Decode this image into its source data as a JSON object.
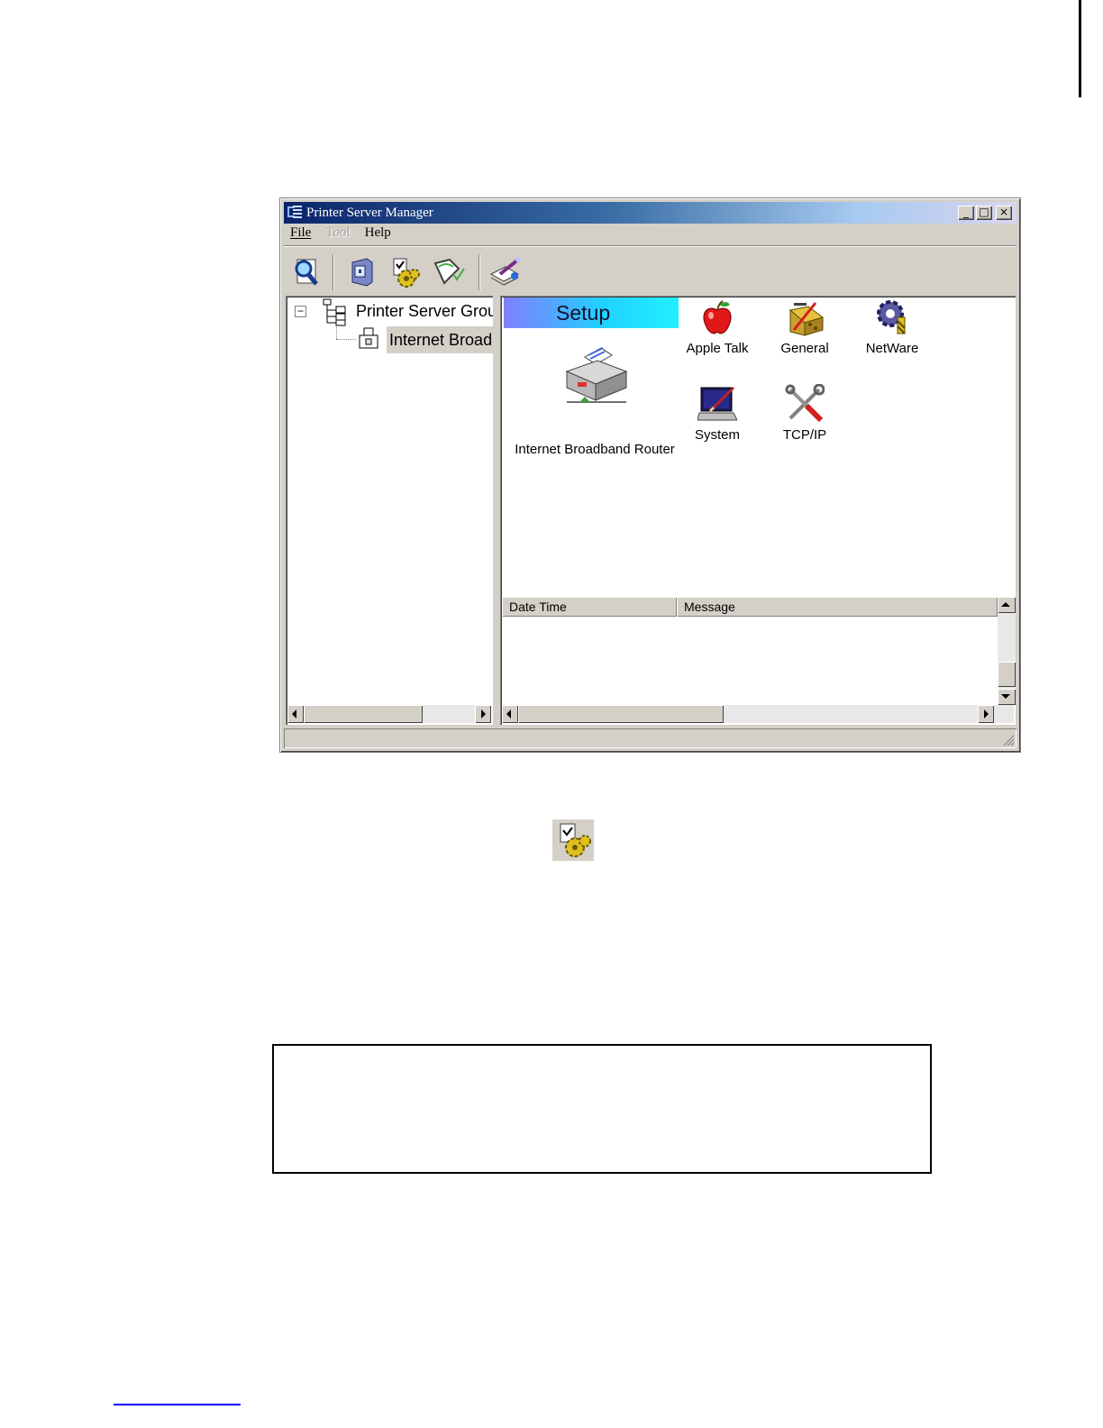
{
  "window": {
    "title": "Printer Server Manager",
    "caption_buttons": {
      "minimize": "_",
      "maximize": "□",
      "close": "×"
    }
  },
  "menu": [
    {
      "label": "File",
      "enabled": true
    },
    {
      "label": "Tool",
      "enabled": false
    },
    {
      "label": "Help",
      "enabled": true
    }
  ],
  "toolbar": {
    "buttons": [
      "search-icon",
      "printer-server-icon",
      "setup-gear-icon",
      "monitor-graph-icon",
      "edit-notes-icon"
    ]
  },
  "tree": {
    "expander": "−",
    "root_label": "Printer Server Group",
    "child_label": "Internet Broadband Router"
  },
  "content": {
    "banner": "Setup",
    "device_label": "Internet Broadband Router",
    "items": [
      {
        "label": "Apple Talk",
        "icon": "apple-icon"
      },
      {
        "label": "General",
        "icon": "general-settings-icon"
      },
      {
        "label": "NetWare",
        "icon": "netware-gear-icon"
      },
      {
        "label": "System",
        "icon": "system-computer-icon"
      },
      {
        "label": "TCP/IP",
        "icon": "tcpip-tools-icon"
      }
    ]
  },
  "log": {
    "columns": [
      "Date Time",
      "Message"
    ]
  },
  "colors": {
    "face": "#d4d0c8",
    "title_start": "#0a246a",
    "banner_end": "#22f0ff",
    "footer_link": "#0000ff"
  }
}
